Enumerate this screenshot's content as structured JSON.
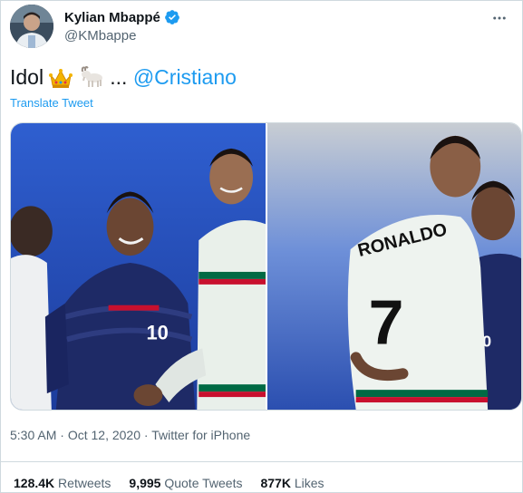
{
  "author": {
    "display_name": "Kylian Mbappé",
    "handle": "@KMbappe",
    "avatar_icon": "profile-avatar",
    "verified_icon": "verified-badge-icon",
    "verified_color": "#1d9bf0"
  },
  "tweet": {
    "text_prefix": "Idol",
    "emoji_1": "crown",
    "emoji_2": "goat",
    "text_ellipsis": "...",
    "mention": "@Cristiano",
    "translate_label": "Translate Tweet",
    "more_icon": "more-options-icon"
  },
  "media": {
    "photo_1_jersey_number": "10",
    "photo_2_name_on_shirt": "RONALDO",
    "photo_2_jersey_number": "7"
  },
  "meta": {
    "time": "5:30 AM",
    "separator_1": " · ",
    "date": "Oct 12, 2020",
    "separator_2": " · ",
    "source": "Twitter for iPhone"
  },
  "stats": {
    "retweets_count": "128.4K",
    "retweets_label": "Retweets",
    "quote_count": "9,995",
    "quote_label": "Quote Tweets",
    "likes_count": "877K",
    "likes_label": "Likes"
  },
  "colors": {
    "accent": "#1d9bf0",
    "text_primary": "#0f1419",
    "text_secondary": "#536471",
    "border": "#cfd9de"
  }
}
